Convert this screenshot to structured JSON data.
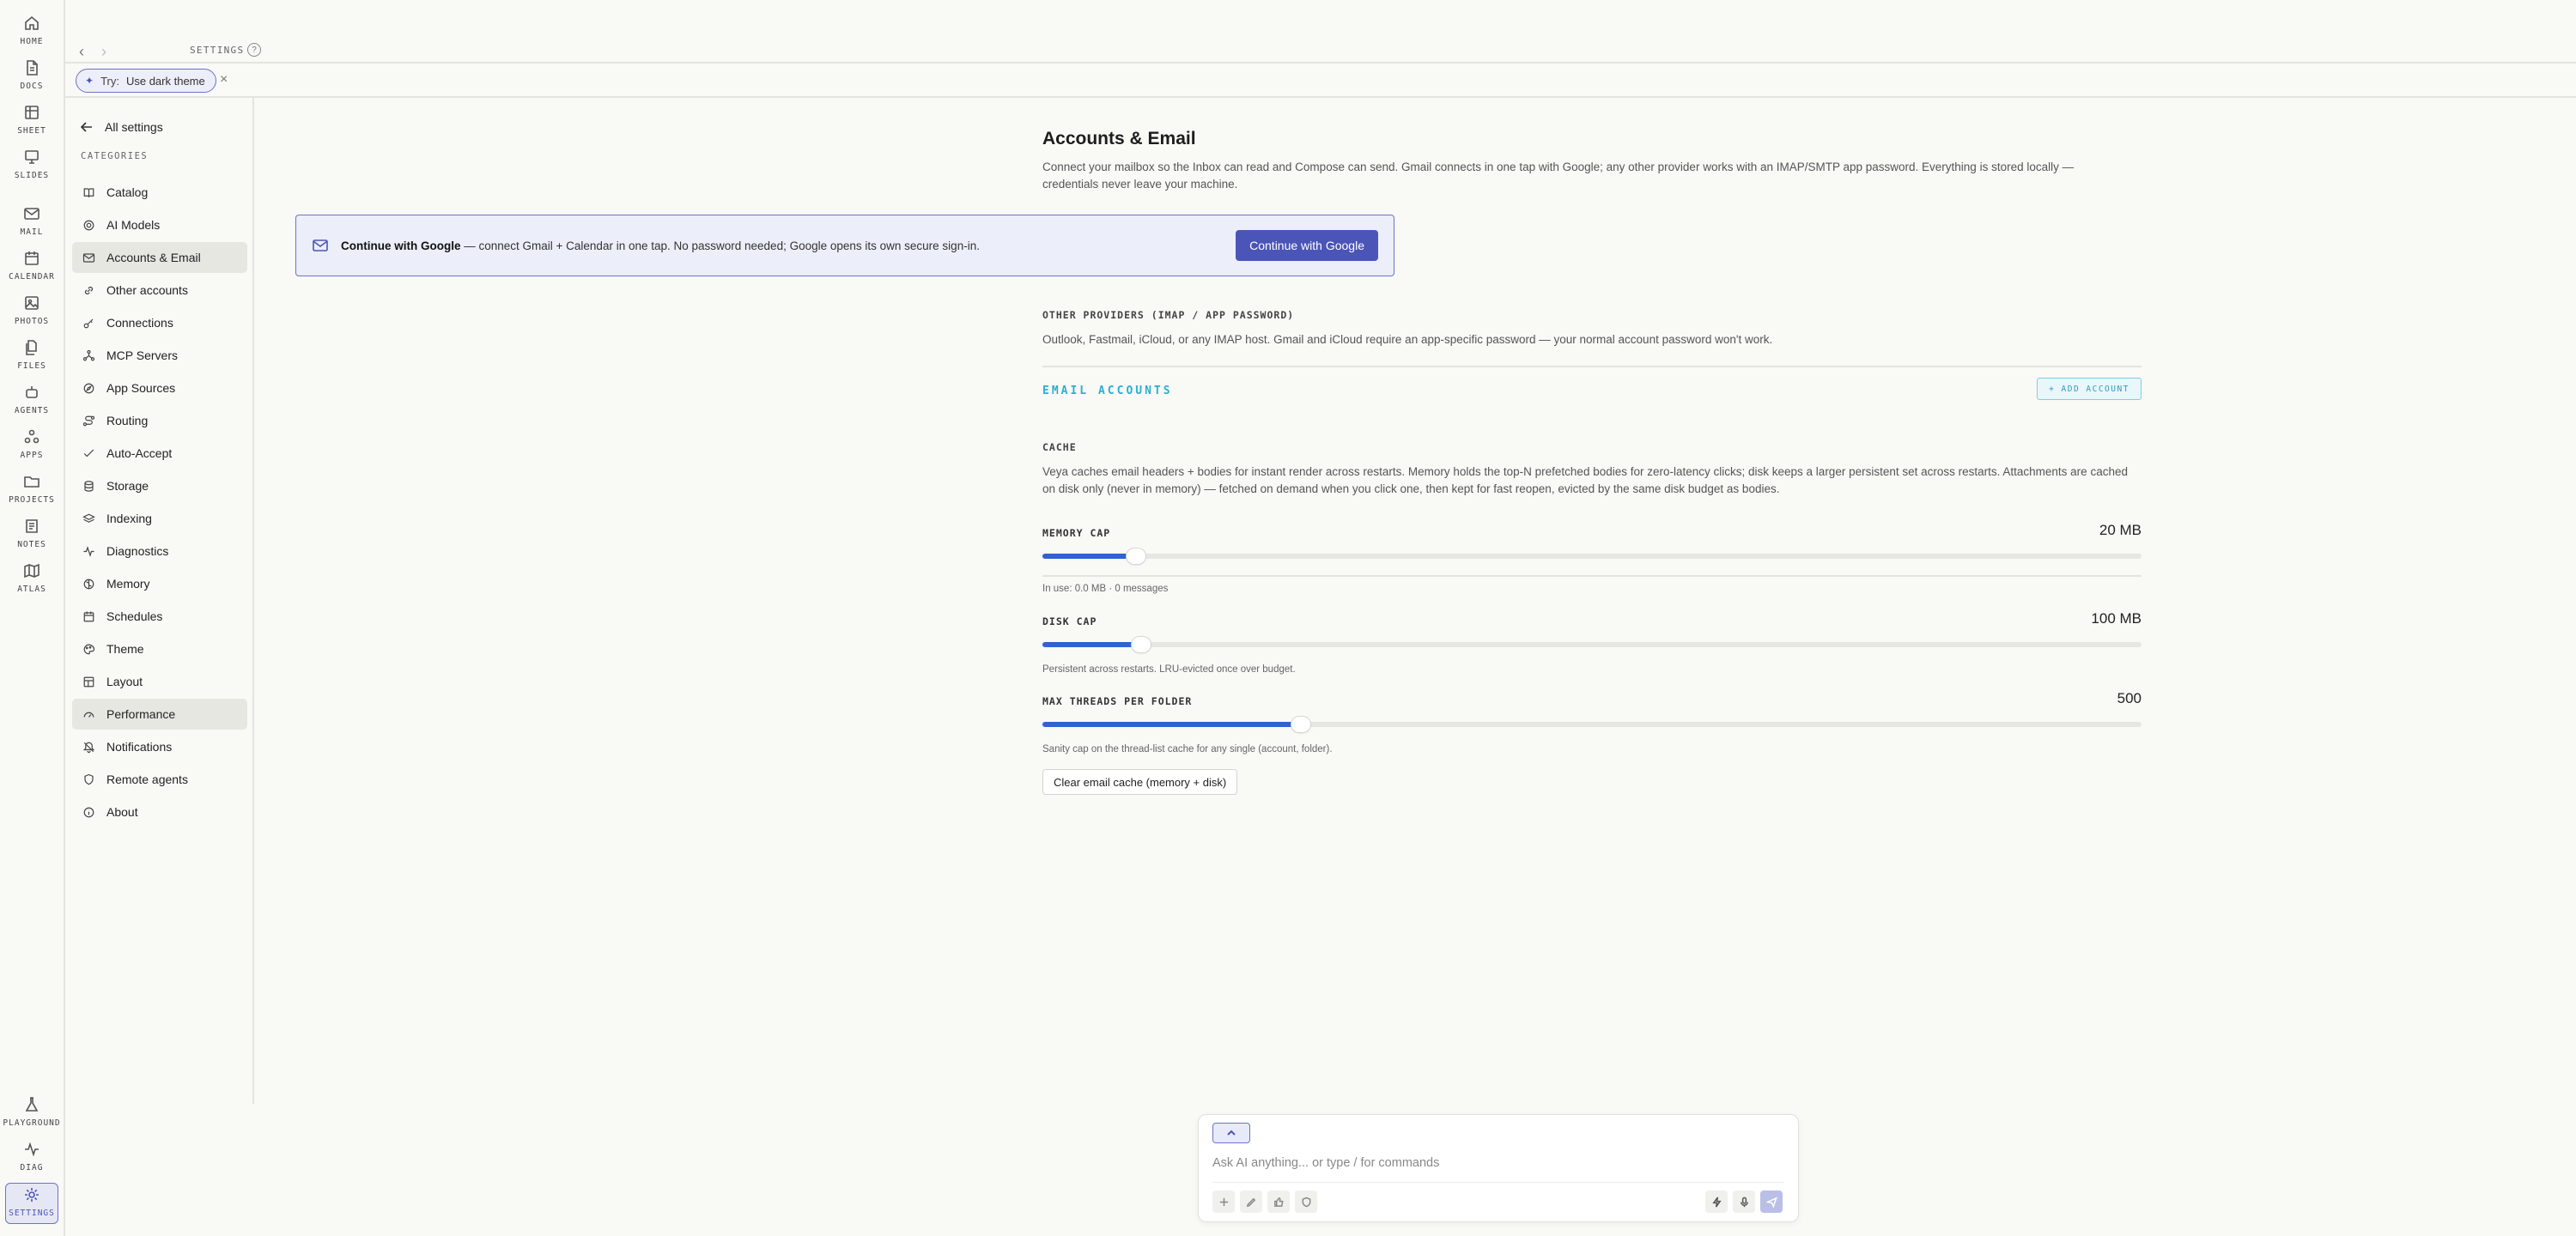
{
  "rail": {
    "top_items": [
      {
        "label": "HOME",
        "icon": "home-icon"
      },
      {
        "label": "DOCS",
        "icon": "document-icon"
      },
      {
        "label": "SHEET",
        "icon": "sheet-icon"
      },
      {
        "label": "SLIDES",
        "icon": "slides-icon"
      },
      {
        "label": "MAIL",
        "icon": "mail-icon"
      },
      {
        "label": "CALENDAR",
        "icon": "calendar-icon"
      },
      {
        "label": "PHOTOS",
        "icon": "photos-icon"
      },
      {
        "label": "FILES",
        "icon": "files-icon"
      },
      {
        "label": "AGENTS",
        "icon": "agents-icon"
      },
      {
        "label": "APPS",
        "icon": "apps-icon"
      },
      {
        "label": "PROJECTS",
        "icon": "folder-icon"
      },
      {
        "label": "NOTES",
        "icon": "notes-icon"
      },
      {
        "label": "ATLAS",
        "icon": "map-icon"
      }
    ],
    "bottom_items": [
      {
        "label": "PLAYGROUND",
        "icon": "flask-icon"
      },
      {
        "label": "DIAG",
        "icon": "pulse-icon"
      },
      {
        "label": "SETTINGS",
        "icon": "gear-icon",
        "active": true
      }
    ]
  },
  "topbar": {
    "breadcrumb": "SETTINGS",
    "help": "?"
  },
  "try_bar": {
    "prefix": "Try:",
    "suggestion": "Use dark theme",
    "close": "×"
  },
  "sidebar": {
    "all_settings": "All settings",
    "categories_label": "CATEGORIES",
    "items": [
      {
        "label": "Catalog",
        "icon": "book-icon"
      },
      {
        "label": "AI Models",
        "icon": "cpu-icon"
      },
      {
        "label": "Accounts & Email",
        "icon": "mail-icon",
        "active": true
      },
      {
        "label": "Other accounts",
        "icon": "link-icon"
      },
      {
        "label": "Connections",
        "icon": "key-icon"
      },
      {
        "label": "MCP Servers",
        "icon": "network-icon"
      },
      {
        "label": "App Sources",
        "icon": "compass-icon"
      },
      {
        "label": "Routing",
        "icon": "route-icon"
      },
      {
        "label": "Auto-Accept",
        "icon": "check-icon"
      },
      {
        "label": "Storage",
        "icon": "database-icon"
      },
      {
        "label": "Indexing",
        "icon": "layers-icon"
      },
      {
        "label": "Diagnostics",
        "icon": "activity-icon"
      },
      {
        "label": "Memory",
        "icon": "brain-icon"
      },
      {
        "label": "Schedules",
        "icon": "calendar-icon"
      },
      {
        "label": "Theme",
        "icon": "palette-icon"
      },
      {
        "label": "Layout",
        "icon": "layout-icon"
      },
      {
        "label": "Performance",
        "icon": "gauge-icon",
        "active": true
      },
      {
        "label": "Notifications",
        "icon": "bell-off-icon"
      },
      {
        "label": "Remote agents",
        "icon": "shield-icon"
      },
      {
        "label": "About",
        "icon": "info-icon"
      }
    ]
  },
  "main": {
    "title": "Accounts & Email",
    "description": "Connect your mailbox so the Inbox can read and Compose can send. Gmail connects in one tap with Google; any other provider works with an IMAP/SMTP app password. Everything is stored locally — credentials never leave your machine.",
    "google_card": {
      "bold": "Continue with Google",
      "text": " — connect Gmail + Calendar in one tap. No password needed; Google opens its own secure sign-in.",
      "button": "Continue with Google"
    },
    "other_providers": {
      "label": "OTHER PROVIDERS (IMAP / APP PASSWORD)",
      "text": "Outlook, Fastmail, iCloud, or any IMAP host. Gmail and iCloud require an app-specific password — your normal account password won't work."
    },
    "email_accounts": {
      "label": "EMAIL ACCOUNTS",
      "add_button": "+ ADD ACCOUNT"
    },
    "cache": {
      "label": "CACHE",
      "description": "Veya caches email headers + bodies for instant render across restarts. Memory holds the top-N prefetched bodies for zero-latency clicks; disk keeps a larger persistent set across restarts. Attachments are cached on disk only (never in memory) — fetched on demand when you click one, then kept for fast reopen, evicted by the same disk budget as bodies.",
      "memory": {
        "label": "MEMORY CAP",
        "value": "20 MB",
        "fraction": 0.085,
        "hint": "In use: 0.0 MB · 0 messages"
      },
      "disk": {
        "label": "DISK CAP",
        "value": "100 MB",
        "fraction": 0.09,
        "hint": "Persistent across restarts. LRU-evicted once over budget."
      },
      "threads": {
        "label": "MAX THREADS PER FOLDER",
        "value": "500",
        "fraction": 0.235,
        "hint": "Sanity cap on the thread-list cache for any single (account, folder)."
      },
      "clear_button": "Clear email cache (memory + disk)"
    }
  },
  "chat": {
    "placeholder": "Ask AI anything... or type / for commands"
  },
  "colors": {
    "accent": "#4b55b8",
    "slider_fill": "#2f62d3",
    "email_accounts": "#2ab0cf"
  }
}
